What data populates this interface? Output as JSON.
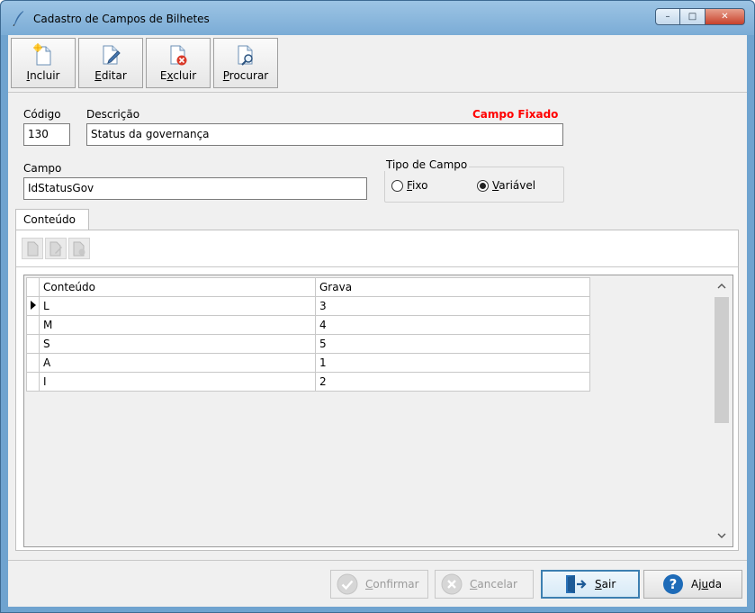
{
  "window": {
    "title": "Cadastro de Campos de Bilhetes",
    "controls": {
      "minimize": "–",
      "maximize": "□",
      "close": "✕"
    }
  },
  "toolbar": {
    "incluir": {
      "prefix": "",
      "key": "I",
      "rest": "ncluir"
    },
    "editar": {
      "prefix": "",
      "key": "E",
      "rest": "ditar"
    },
    "excluir": {
      "prefix": "E",
      "key": "x",
      "rest": "cluir"
    },
    "procurar": {
      "prefix": "",
      "key": "P",
      "rest": "rocurar"
    }
  },
  "form": {
    "codigo_label": "Código",
    "codigo_value": "130",
    "descricao_label": "Descrição",
    "descricao_value": "Status da governança",
    "campo_fixado": "Campo Fixado",
    "campo_label": "Campo",
    "campo_value": "IdStatusGov",
    "tipo_label": "Tipo de Campo",
    "tipo_options": [
      {
        "key": "F",
        "rest": "ixo",
        "selected": false
      },
      {
        "key": "V",
        "rest": "ariável",
        "selected": true
      }
    ]
  },
  "tab": {
    "label": "Conteúdo"
  },
  "grid": {
    "columns": [
      "Conteúdo",
      "Grava"
    ],
    "rows": [
      {
        "conteudo": "L",
        "grava": "3",
        "current": true
      },
      {
        "conteudo": "M",
        "grava": "4",
        "current": false
      },
      {
        "conteudo": "S",
        "grava": "5",
        "current": false
      },
      {
        "conteudo": "A",
        "grava": "1",
        "current": false
      },
      {
        "conteudo": "I",
        "grava": "2",
        "current": false
      }
    ]
  },
  "actions": {
    "confirmar": {
      "key": "C",
      "rest": "onfirmar"
    },
    "cancelar": {
      "key": "C",
      "rest": "ancelar"
    },
    "sair": {
      "key": "S",
      "rest": "air"
    },
    "ajuda": {
      "prefix": "Aj",
      "key": "u",
      "rest": "da"
    }
  },
  "colors": {
    "title_bar": "#7bacd6",
    "accent_red": "#ff0000",
    "focus_border": "#3c7fb1",
    "help_blue": "#1e6bb8"
  }
}
